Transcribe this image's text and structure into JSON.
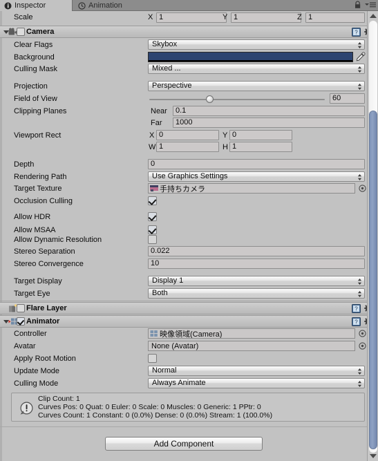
{
  "window": {
    "tabs": [
      {
        "label": "Inspector",
        "icon": "info-icon",
        "active": true
      },
      {
        "label": "Animation",
        "icon": "clock-icon",
        "active": false
      }
    ],
    "lock_icon": "lock-icon",
    "menu_icon": "hamburger-menu-icon"
  },
  "transform": {
    "scale_label": "Scale",
    "axes": [
      {
        "axis": "X",
        "value": "1"
      },
      {
        "axis": "Y",
        "value": "1"
      },
      {
        "axis": "Z",
        "value": "1"
      }
    ]
  },
  "camera": {
    "title": "Camera",
    "enabled": false,
    "expanded": true,
    "icon": "camera-icon",
    "help_icon": "help-book-icon",
    "gear_icon": "gear-icon",
    "clear_flags": {
      "label": "Clear Flags",
      "value": "Skybox"
    },
    "background": {
      "label": "Background",
      "color": "#2d4470",
      "eyedropper_icon": "eyedropper-icon"
    },
    "culling_mask": {
      "label": "Culling Mask",
      "value": "Mixed ..."
    },
    "projection": {
      "label": "Projection",
      "value": "Perspective"
    },
    "field_of_view": {
      "label": "Field of View",
      "value": "60",
      "min": 1,
      "max": 179
    },
    "clipping_planes": {
      "label": "Clipping Planes",
      "near_label": "Near",
      "near_value": "0.1",
      "far_label": "Far",
      "far_value": "1000"
    },
    "viewport_rect": {
      "label": "Viewport Rect",
      "x_label": "X",
      "x_value": "0",
      "y_label": "Y",
      "y_value": "0",
      "w_label": "W",
      "w_value": "1",
      "h_label": "H",
      "h_value": "1"
    },
    "depth": {
      "label": "Depth",
      "value": "0"
    },
    "rendering_path": {
      "label": "Rendering Path",
      "value": "Use Graphics Settings"
    },
    "target_texture": {
      "label": "Target Texture",
      "value": "手持ちカメラ",
      "icon": "render-texture-icon",
      "picker_icon": "object-picker-icon"
    },
    "occlusion_culling": {
      "label": "Occlusion Culling",
      "checked": true
    },
    "allow_hdr": {
      "label": "Allow HDR",
      "checked": true
    },
    "allow_msaa": {
      "label": "Allow MSAA",
      "checked": true
    },
    "allow_dynamic_resolution": {
      "label": "Allow Dynamic Resolution",
      "checked": false
    },
    "stereo_separation": {
      "label": "Stereo Separation",
      "value": "0.022"
    },
    "stereo_convergence": {
      "label": "Stereo Convergence",
      "value": "10"
    },
    "target_display": {
      "label": "Target Display",
      "value": "Display 1"
    },
    "target_eye": {
      "label": "Target Eye",
      "value": "Both"
    }
  },
  "flare_layer": {
    "title": "Flare Layer",
    "enabled": false,
    "icon": "flare-layer-icon",
    "help_icon": "help-book-icon",
    "gear_icon": "gear-icon"
  },
  "animator": {
    "title": "Animator",
    "enabled": true,
    "expanded": true,
    "icon": "animator-icon",
    "help_icon": "help-book-icon",
    "gear_icon": "gear-icon",
    "controller": {
      "label": "Controller",
      "value": "映像領域(Camera)",
      "icon": "animator-controller-icon",
      "picker_icon": "object-picker-icon"
    },
    "avatar": {
      "label": "Avatar",
      "value": "None (Avatar)",
      "picker_icon": "object-picker-icon"
    },
    "apply_root_motion": {
      "label": "Apply Root Motion",
      "checked": false
    },
    "update_mode": {
      "label": "Update Mode",
      "value": "Normal"
    },
    "culling_mode": {
      "label": "Culling Mode",
      "value": "Always Animate"
    },
    "info_box": {
      "icon": "warning-icon",
      "line1": "Clip Count: 1",
      "line2": "Curves Pos: 0 Quat: 0 Euler: 0 Scale: 0 Muscles: 0 Generic: 1 PPtr: 0",
      "line3": "Curves Count: 1 Constant: 0 (0.0%) Dense: 0 (0.0%) Stream: 1 (100.0%)"
    }
  },
  "footer": {
    "add_component_label": "Add Component"
  }
}
